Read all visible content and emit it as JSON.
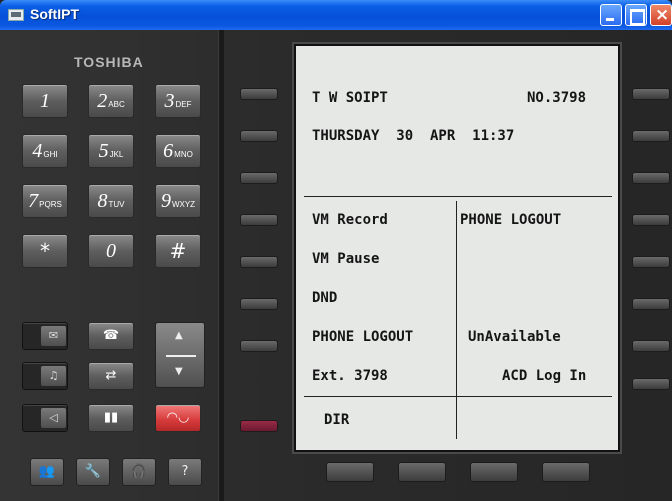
{
  "window": {
    "title": "SoftIPT"
  },
  "brand": "TOSHIBA",
  "keypad": {
    "keys": [
      {
        "digit": "1",
        "letters": ""
      },
      {
        "digit": "2",
        "letters": "ABC"
      },
      {
        "digit": "3",
        "letters": "DEF"
      },
      {
        "digit": "4",
        "letters": "GHI"
      },
      {
        "digit": "5",
        "letters": "JKL"
      },
      {
        "digit": "6",
        "letters": "MNO"
      },
      {
        "digit": "7",
        "letters": "PQRS"
      },
      {
        "digit": "8",
        "letters": "TUV"
      },
      {
        "digit": "9",
        "letters": "WXYZ"
      },
      {
        "digit": "*",
        "letters": ""
      },
      {
        "digit": "0",
        "letters": ""
      },
      {
        "digit": "#",
        "letters": ""
      }
    ]
  },
  "display": {
    "line1_left": "T W SOIPT",
    "line1_right": "NO.3798",
    "date_line": "THURSDAY  30  APR  11:37",
    "left_items": [
      "VM Record",
      "VM Pause",
      "DND",
      "PHONE LOGOUT",
      "Ext. 3798"
    ],
    "right_items": [
      "PHONE LOGOUT",
      "UnAvailable",
      "ACD Log In"
    ],
    "bottom": "DIR"
  },
  "icons": {
    "message": "✉",
    "mic": "&#9901;",
    "speaker": "◁",
    "up_arrow": "▲",
    "down_arrow": "▼",
    "help": "?"
  }
}
